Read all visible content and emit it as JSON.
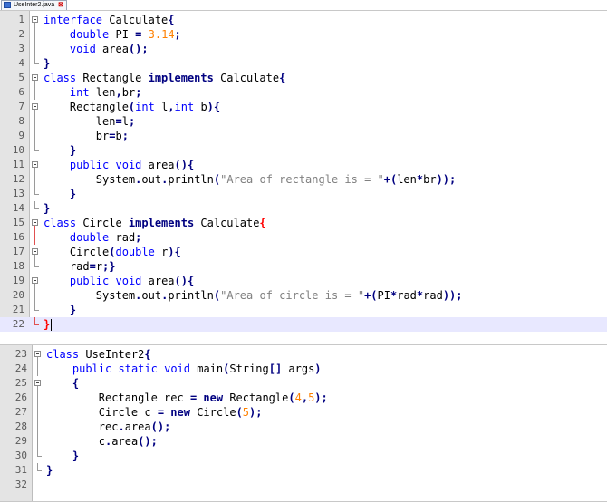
{
  "tab": {
    "label": "UseInter2.java",
    "close": "⊠"
  },
  "editor1": {
    "lines": [
      {
        "n": "1",
        "fold": "box",
        "tokens": [
          [
            "kw",
            "interface"
          ],
          [
            "id",
            " Calculate"
          ],
          [
            "op",
            "{"
          ]
        ]
      },
      {
        "n": "2",
        "fold": "line",
        "tokens": [
          [
            "id",
            "    "
          ],
          [
            "kw",
            "double"
          ],
          [
            "id",
            " PI "
          ],
          [
            "op",
            "="
          ],
          [
            "id",
            " "
          ],
          [
            "num",
            "3.14"
          ],
          [
            "op",
            ";"
          ]
        ]
      },
      {
        "n": "3",
        "fold": "line",
        "tokens": [
          [
            "id",
            "    "
          ],
          [
            "kw",
            "void"
          ],
          [
            "id",
            " area"
          ],
          [
            "op",
            "();"
          ]
        ]
      },
      {
        "n": "4",
        "fold": "end",
        "tokens": [
          [
            "op",
            "}"
          ]
        ]
      },
      {
        "n": "5",
        "fold": "box",
        "tokens": [
          [
            "kw",
            "class"
          ],
          [
            "id",
            " Rectangle "
          ],
          [
            "bold",
            "implements"
          ],
          [
            "id",
            " Calculate"
          ],
          [
            "op",
            "{"
          ]
        ]
      },
      {
        "n": "6",
        "fold": "line",
        "tokens": [
          [
            "id",
            "    "
          ],
          [
            "kw",
            "int"
          ],
          [
            "id",
            " len"
          ],
          [
            "op",
            ","
          ],
          [
            "id",
            "br"
          ],
          [
            "op",
            ";"
          ]
        ]
      },
      {
        "n": "7",
        "fold": "box",
        "tokens": [
          [
            "id",
            "    Rectangle"
          ],
          [
            "op",
            "("
          ],
          [
            "kw",
            "int"
          ],
          [
            "id",
            " l"
          ],
          [
            "op",
            ","
          ],
          [
            "kw",
            "int"
          ],
          [
            "id",
            " b"
          ],
          [
            "op",
            "){"
          ]
        ]
      },
      {
        "n": "8",
        "fold": "line",
        "tokens": [
          [
            "id",
            "        len"
          ],
          [
            "op",
            "="
          ],
          [
            "id",
            "l"
          ],
          [
            "op",
            ";"
          ]
        ]
      },
      {
        "n": "9",
        "fold": "line",
        "tokens": [
          [
            "id",
            "        br"
          ],
          [
            "op",
            "="
          ],
          [
            "id",
            "b"
          ],
          [
            "op",
            ";"
          ]
        ]
      },
      {
        "n": "10",
        "fold": "end",
        "tokens": [
          [
            "id",
            "    "
          ],
          [
            "op",
            "}"
          ]
        ]
      },
      {
        "n": "11",
        "fold": "box",
        "tokens": [
          [
            "id",
            "    "
          ],
          [
            "kw",
            "public"
          ],
          [
            "id",
            " "
          ],
          [
            "kw",
            "void"
          ],
          [
            "id",
            " area"
          ],
          [
            "op",
            "(){"
          ]
        ]
      },
      {
        "n": "12",
        "fold": "line",
        "tokens": [
          [
            "id",
            "        System"
          ],
          [
            "op",
            "."
          ],
          [
            "id",
            "out"
          ],
          [
            "op",
            "."
          ],
          [
            "id",
            "println"
          ],
          [
            "op",
            "("
          ],
          [
            "str",
            "\"Area of rectangle is = \""
          ],
          [
            "op",
            "+("
          ],
          [
            "id",
            "len"
          ],
          [
            "op",
            "*"
          ],
          [
            "id",
            "br"
          ],
          [
            "op",
            "));"
          ]
        ]
      },
      {
        "n": "13",
        "fold": "end",
        "tokens": [
          [
            "id",
            "    "
          ],
          [
            "op",
            "}"
          ]
        ]
      },
      {
        "n": "14",
        "fold": "end",
        "tokens": [
          [
            "op",
            "}"
          ]
        ]
      },
      {
        "n": "15",
        "fold": "boxred",
        "tokens": [
          [
            "kw",
            "class"
          ],
          [
            "id",
            " Circle "
          ],
          [
            "bold",
            "implements"
          ],
          [
            "id",
            " Calculate"
          ],
          [
            "redbrace",
            "{"
          ]
        ]
      },
      {
        "n": "16",
        "fold": "linered",
        "tokens": [
          [
            "id",
            "    "
          ],
          [
            "kw",
            "double"
          ],
          [
            "id",
            " rad"
          ],
          [
            "op",
            ";"
          ]
        ]
      },
      {
        "n": "17",
        "fold": "box",
        "tokens": [
          [
            "id",
            "    Circle"
          ],
          [
            "op",
            "("
          ],
          [
            "kw",
            "double"
          ],
          [
            "id",
            " r"
          ],
          [
            "op",
            "){"
          ]
        ]
      },
      {
        "n": "18",
        "fold": "end",
        "tokens": [
          [
            "id",
            "    rad"
          ],
          [
            "op",
            "="
          ],
          [
            "id",
            "r"
          ],
          [
            "op",
            ";}"
          ]
        ]
      },
      {
        "n": "19",
        "fold": "box",
        "tokens": [
          [
            "id",
            "    "
          ],
          [
            "kw",
            "public"
          ],
          [
            "id",
            " "
          ],
          [
            "kw",
            "void"
          ],
          [
            "id",
            " area"
          ],
          [
            "op",
            "(){"
          ]
        ]
      },
      {
        "n": "20",
        "fold": "line",
        "tokens": [
          [
            "id",
            "        System"
          ],
          [
            "op",
            "."
          ],
          [
            "id",
            "out"
          ],
          [
            "op",
            "."
          ],
          [
            "id",
            "println"
          ],
          [
            "op",
            "("
          ],
          [
            "str",
            "\"Area of circle is = \""
          ],
          [
            "op",
            "+("
          ],
          [
            "id",
            "PI"
          ],
          [
            "op",
            "*"
          ],
          [
            "id",
            "rad"
          ],
          [
            "op",
            "*"
          ],
          [
            "id",
            "rad"
          ],
          [
            "op",
            "));"
          ]
        ]
      },
      {
        "n": "21",
        "fold": "end",
        "tokens": [
          [
            "id",
            "    "
          ],
          [
            "op",
            "}"
          ]
        ]
      },
      {
        "n": "22",
        "fold": "endred",
        "cursor": true,
        "tokens": [
          [
            "redbrace",
            "}"
          ]
        ]
      }
    ]
  },
  "editor2": {
    "lines": [
      {
        "n": "23",
        "fold": "box",
        "tokens": [
          [
            "kw",
            "class"
          ],
          [
            "id",
            " UseInter2"
          ],
          [
            "op",
            "{"
          ]
        ]
      },
      {
        "n": "24",
        "fold": "line",
        "tokens": [
          [
            "id",
            "    "
          ],
          [
            "kw",
            "public"
          ],
          [
            "id",
            " "
          ],
          [
            "kw",
            "static"
          ],
          [
            "id",
            " "
          ],
          [
            "kw",
            "void"
          ],
          [
            "id",
            " main"
          ],
          [
            "op",
            "("
          ],
          [
            "id",
            "String"
          ],
          [
            "op",
            "[]"
          ],
          [
            "id",
            " args"
          ],
          [
            "op",
            ")"
          ]
        ]
      },
      {
        "n": "25",
        "fold": "box",
        "tokens": [
          [
            "id",
            "    "
          ],
          [
            "op",
            "{"
          ]
        ]
      },
      {
        "n": "26",
        "fold": "line",
        "tokens": [
          [
            "id",
            "        Rectangle rec "
          ],
          [
            "op",
            "="
          ],
          [
            "id",
            " "
          ],
          [
            "bold",
            "new"
          ],
          [
            "id",
            " Rectangle"
          ],
          [
            "op",
            "("
          ],
          [
            "num",
            "4"
          ],
          [
            "op",
            ","
          ],
          [
            "num",
            "5"
          ],
          [
            "op",
            ");"
          ]
        ]
      },
      {
        "n": "27",
        "fold": "line",
        "tokens": [
          [
            "id",
            "        Circle c "
          ],
          [
            "op",
            "="
          ],
          [
            "id",
            " "
          ],
          [
            "bold",
            "new"
          ],
          [
            "id",
            " Circle"
          ],
          [
            "op",
            "("
          ],
          [
            "num",
            "5"
          ],
          [
            "op",
            ");"
          ]
        ]
      },
      {
        "n": "28",
        "fold": "line",
        "tokens": [
          [
            "id",
            "        rec"
          ],
          [
            "op",
            "."
          ],
          [
            "id",
            "area"
          ],
          [
            "op",
            "();"
          ]
        ]
      },
      {
        "n": "29",
        "fold": "line",
        "tokens": [
          [
            "id",
            "        c"
          ],
          [
            "op",
            "."
          ],
          [
            "id",
            "area"
          ],
          [
            "op",
            "();"
          ]
        ]
      },
      {
        "n": "30",
        "fold": "end",
        "tokens": [
          [
            "id",
            "    "
          ],
          [
            "op",
            "}"
          ]
        ]
      },
      {
        "n": "31",
        "fold": "end",
        "tokens": [
          [
            "op",
            "}"
          ]
        ]
      },
      {
        "n": "32",
        "fold": "none",
        "tokens": []
      }
    ]
  }
}
